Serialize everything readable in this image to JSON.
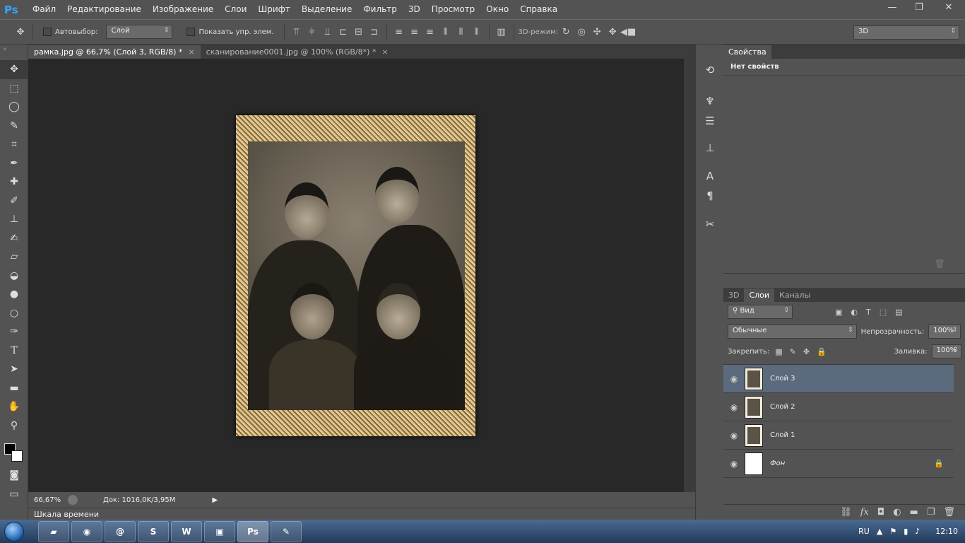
{
  "app": {
    "logo": "Ps",
    "menu": [
      "Файл",
      "Редактирование",
      "Изображение",
      "Слои",
      "Шрифт",
      "Выделение",
      "Фильтр",
      "3D",
      "Просмотр",
      "Окно",
      "Справка"
    ]
  },
  "window_buttons": {
    "minimize": "—",
    "restore": "❐",
    "close": "✕"
  },
  "options": {
    "autoselect_label": "Автовыбор:",
    "autoselect_value": "Слой",
    "show_controls_label": "Показать упр. элем.",
    "mode_3d_label": "3D-режим:",
    "workspace_value": "3D"
  },
  "tabs": [
    {
      "label": "рамка.jpg @ 66,7% (Слой 3, RGB/8) *",
      "close": "×"
    },
    {
      "label": "сканирование0001.jpg @ 100% (RGB/8*) *",
      "close": "×"
    }
  ],
  "status": {
    "zoom": "66,67%",
    "doc": "Док: 1016,0K/3,95M"
  },
  "timeline_label": "Шкала времени",
  "properties": {
    "tab": "Свойства",
    "empty_text": "Нет свойств"
  },
  "layers_panel": {
    "tabs": [
      "3D",
      "Слои",
      "Каналы"
    ],
    "filter_value": "Вид",
    "blend_mode": "Обычные",
    "opacity_label": "Непрозрачность:",
    "opacity_value": "100%",
    "lock_label": "Закрепить:",
    "fill_label": "Заливка:",
    "fill_value": "100%",
    "layers": [
      {
        "name": "Слой 3"
      },
      {
        "name": "Слой 2"
      },
      {
        "name": "Слой 1"
      },
      {
        "name": "Фон"
      }
    ]
  },
  "tray": {
    "lang": "RU",
    "time": "12:10"
  },
  "taskbar_apps": [
    "explorer",
    "chrome",
    "network",
    "skype",
    "word",
    "presentation",
    "photoshop",
    "paint"
  ],
  "accent": "#31a8ff"
}
